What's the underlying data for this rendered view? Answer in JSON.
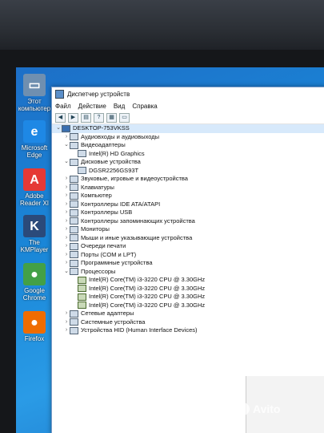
{
  "desktop": {
    "icons": [
      {
        "label": "Этот компьютер",
        "icon": "computer-icon",
        "color": "#6f8fb0"
      },
      {
        "label": "Microsoft Edge",
        "icon": "edge-icon",
        "color": "#1e88e5"
      },
      {
        "label": "Adobe Reader XI",
        "icon": "adobe-reader-icon",
        "color": "#e53935"
      },
      {
        "label": "The KMPlayer",
        "icon": "kmplayer-icon",
        "color": "#2b4a7a"
      },
      {
        "label": "Google Chrome",
        "icon": "chrome-icon",
        "color": "#43a047"
      },
      {
        "label": "Firefox",
        "icon": "firefox-icon",
        "color": "#ef6c00"
      }
    ]
  },
  "window": {
    "title": "Диспетчер устройств",
    "menu": [
      "Файл",
      "Действие",
      "Вид",
      "Справка"
    ]
  },
  "tree": [
    {
      "level": 0,
      "exp": "⌄",
      "label": "DESKTOP-753VKSS",
      "kind": "root"
    },
    {
      "level": 1,
      "exp": "›",
      "label": "Аудиовходы и аудиовыходы",
      "kind": "cat"
    },
    {
      "level": 1,
      "exp": "⌄",
      "label": "Видеоадаптеры",
      "kind": "cat"
    },
    {
      "level": 2,
      "exp": "",
      "label": "Intel(R) HD Graphics",
      "kind": "dev"
    },
    {
      "level": 1,
      "exp": "⌄",
      "label": "Дисковые устройства",
      "kind": "cat"
    },
    {
      "level": 2,
      "exp": "",
      "label": "DGSR2256GS93T",
      "kind": "dev"
    },
    {
      "level": 1,
      "exp": "›",
      "label": "Звуковые, игровые и видеоустройства",
      "kind": "cat"
    },
    {
      "level": 1,
      "exp": "›",
      "label": "Клавиатуры",
      "kind": "cat"
    },
    {
      "level": 1,
      "exp": "›",
      "label": "Компьютер",
      "kind": "cat"
    },
    {
      "level": 1,
      "exp": "›",
      "label": "Контроллеры IDE ATA/ATAPI",
      "kind": "cat"
    },
    {
      "level": 1,
      "exp": "›",
      "label": "Контроллеры USB",
      "kind": "cat"
    },
    {
      "level": 1,
      "exp": "›",
      "label": "Контроллеры запоминающих устройства",
      "kind": "cat"
    },
    {
      "level": 1,
      "exp": "›",
      "label": "Мониторы",
      "kind": "cat"
    },
    {
      "level": 1,
      "exp": "›",
      "label": "Мыши и иные указывающие устройства",
      "kind": "cat"
    },
    {
      "level": 1,
      "exp": "›",
      "label": "Очереди печати",
      "kind": "cat"
    },
    {
      "level": 1,
      "exp": "›",
      "label": "Порты (COM и LPT)",
      "kind": "cat"
    },
    {
      "level": 1,
      "exp": "›",
      "label": "Программные устройства",
      "kind": "cat"
    },
    {
      "level": 1,
      "exp": "⌄",
      "label": "Процессоры",
      "kind": "cat"
    },
    {
      "level": 2,
      "exp": "",
      "label": "Intel(R) Core(TM) i3-3220 CPU @ 3.30GHz",
      "kind": "proc"
    },
    {
      "level": 2,
      "exp": "",
      "label": "Intel(R) Core(TM) i3-3220 CPU @ 3.30GHz",
      "kind": "proc"
    },
    {
      "level": 2,
      "exp": "",
      "label": "Intel(R) Core(TM) i3-3220 CPU @ 3.30GHz",
      "kind": "proc"
    },
    {
      "level": 2,
      "exp": "",
      "label": "Intel(R) Core(TM) i3-3220 CPU @ 3.30GHz",
      "kind": "proc"
    },
    {
      "level": 1,
      "exp": "›",
      "label": "Сетевые адаптеры",
      "kind": "cat"
    },
    {
      "level": 1,
      "exp": "›",
      "label": "Системные устройства",
      "kind": "cat"
    },
    {
      "level": 1,
      "exp": "›",
      "label": "Устройства HID (Human Interface Devices)",
      "kind": "cat"
    }
  ],
  "watermark": "Avito"
}
